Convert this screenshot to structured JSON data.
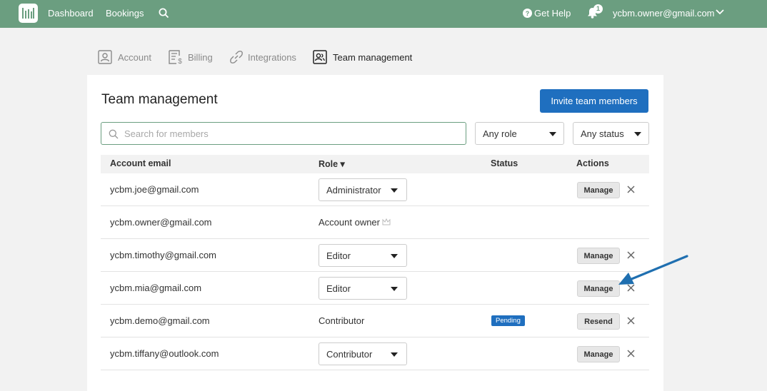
{
  "topbar": {
    "nav": [
      "Dashboard",
      "Bookings"
    ],
    "help_label": "Get Help",
    "notification_count": "1",
    "user_email": "ycbm.owner@gmail.com"
  },
  "tabs": [
    {
      "label": "Account",
      "icon": "account-icon",
      "active": false
    },
    {
      "label": "Billing",
      "icon": "billing-icon",
      "active": false
    },
    {
      "label": "Integrations",
      "icon": "integrations-icon",
      "active": false
    },
    {
      "label": "Team management",
      "icon": "team-icon",
      "active": true
    }
  ],
  "page": {
    "title": "Team management",
    "invite_label": "Invite team members",
    "search_placeholder": "Search for members",
    "role_filter": "Any role",
    "status_filter": "Any status"
  },
  "table": {
    "headers": {
      "email": "Account email",
      "role": "Role ▾",
      "status": "Status",
      "actions": "Actions"
    },
    "rows": [
      {
        "email": "ycbm.joe@gmail.com",
        "role": "Administrator",
        "status": "",
        "action": "Manage"
      },
      {
        "email": "ycbm.owner@gmail.com",
        "role": "Account owner",
        "status": "",
        "action": ""
      },
      {
        "email": "ycbm.timothy@gmail.com",
        "role": "Editor",
        "status": "",
        "action": "Manage"
      },
      {
        "email": "ycbm.mia@gmail.com",
        "role": "Editor",
        "status": "",
        "action": "Manage"
      },
      {
        "email": "ycbm.demo@gmail.com",
        "role": "Contributor",
        "status": "Pending",
        "action": "Resend"
      },
      {
        "email": "ycbm.tiffany@outlook.com",
        "role": "Contributor",
        "status": "",
        "action": "Manage"
      }
    ]
  },
  "colors": {
    "topbar": "#6b9e80",
    "primary": "#1f6fbf",
    "arrow": "#1f6fb0"
  }
}
